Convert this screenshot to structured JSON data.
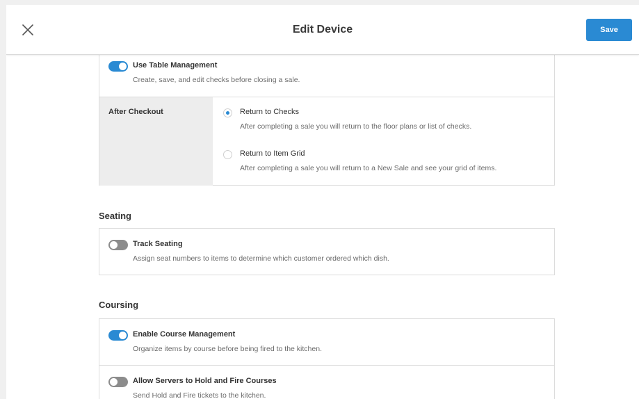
{
  "header": {
    "title": "Edit Device",
    "save_label": "Save",
    "close_icon": "close-icon"
  },
  "table_management": {
    "toggle_on": true,
    "title": "Use Table Management",
    "description": "Create, save, and edit checks before closing a sale.",
    "after_checkout": {
      "label": "After Checkout",
      "options": [
        {
          "title": "Return to Checks",
          "description": "After completing a sale you will return to the floor plans or list of checks.",
          "selected": true
        },
        {
          "title": "Return to Item Grid",
          "description": "After completing a sale you will return to a New Sale and see your grid of items.",
          "selected": false
        }
      ]
    }
  },
  "seating": {
    "section_title": "Seating",
    "items": [
      {
        "toggle_on": false,
        "title": "Track Seating",
        "description": "Assign seat numbers to items to determine which customer ordered which dish."
      }
    ]
  },
  "coursing": {
    "section_title": "Coursing",
    "items": [
      {
        "toggle_on": true,
        "title": "Enable Course Management",
        "description": "Organize items by course before being fired to the kitchen."
      },
      {
        "toggle_on": false,
        "title": "Allow Servers to Hold and Fire Courses",
        "description": "Send Hold and Fire tickets to the kitchen."
      }
    ]
  },
  "colors": {
    "accent": "#2a8ad3",
    "toggle_off": "#8c8c8c",
    "border": "#dcdcdc"
  }
}
